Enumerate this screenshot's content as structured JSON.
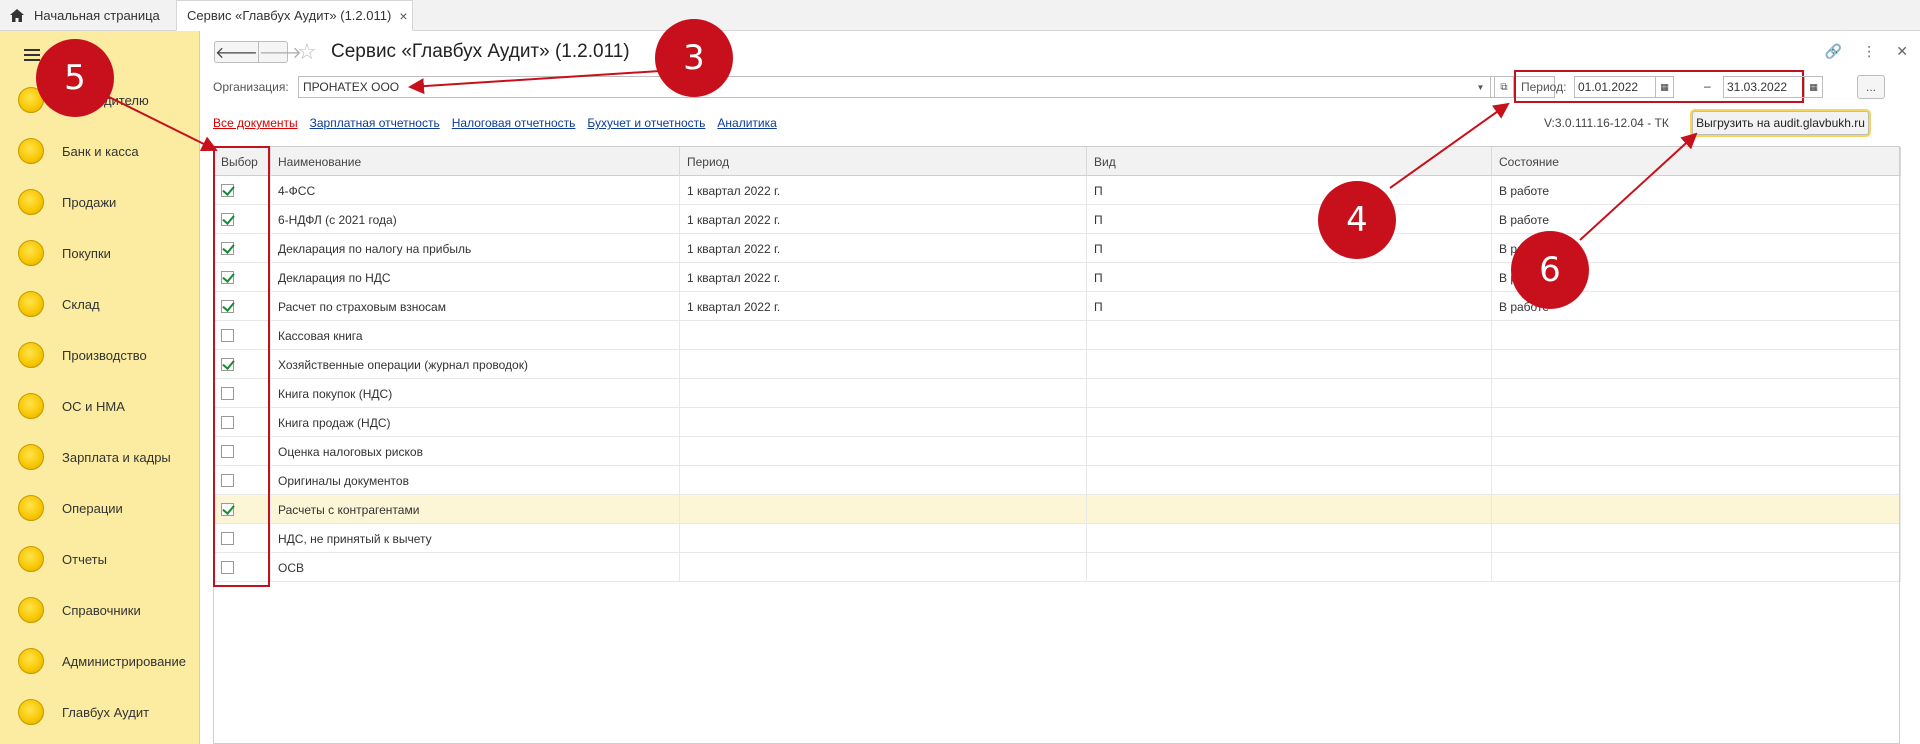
{
  "tabs": {
    "home_label": "Начальная страница",
    "active_label": "Сервис «Главбух Аудит» (1.2.011)",
    "close": "×"
  },
  "sidebar": {
    "items": [
      {
        "label": "Руководителю"
      },
      {
        "label": "Банк и касса"
      },
      {
        "label": "Продажи"
      },
      {
        "label": "Покупки"
      },
      {
        "label": "Склад"
      },
      {
        "label": "Производство"
      },
      {
        "label": "ОС и НМА"
      },
      {
        "label": "Зарплата и кадры"
      },
      {
        "label": "Операции"
      },
      {
        "label": "Отчеты"
      },
      {
        "label": "Справочники"
      },
      {
        "label": "Администрирование"
      },
      {
        "label": "Главбух Аудит"
      }
    ]
  },
  "header": {
    "title": "Сервис «Главбух Аудит» (1.2.011)",
    "back": "🡐",
    "forward": "🡒"
  },
  "org": {
    "label": "Организация:",
    "value": "ПРОНАТЕХ ООО"
  },
  "period": {
    "label": "Период:",
    "from": "01.01.2022",
    "to": "31.03.2022",
    "dash": "–",
    "more": "..."
  },
  "links": [
    "Все документы",
    "Зарплатная отчетность",
    "Налоговая отчетность",
    "Бухучет и отчетность",
    "Аналитика"
  ],
  "version": "V:3.0.111.16-12.04 -  ТК",
  "upload_button": "Выгрузить на audit.glavbukh.ru",
  "table": {
    "columns": [
      "Выбор",
      "Наименование",
      "Период",
      "Вид",
      "Состояние"
    ],
    "rows": [
      {
        "checked": true,
        "name": "4-ФСС",
        "period": "1 квартал 2022 г.",
        "kind": "П",
        "state": "В работе"
      },
      {
        "checked": true,
        "name": "6-НДФЛ (с 2021 года)",
        "period": "1 квартал 2022 г.",
        "kind": "П",
        "state": "В работе"
      },
      {
        "checked": true,
        "name": "Декларация по налогу на прибыль",
        "period": "1 квартал 2022 г.",
        "kind": "П",
        "state": "В работе"
      },
      {
        "checked": true,
        "name": "Декларация по НДС",
        "period": "1 квартал 2022 г.",
        "kind": "П",
        "state": "В работе"
      },
      {
        "checked": true,
        "name": "Расчет по страховым взносам",
        "period": "1 квартал 2022 г.",
        "kind": "П",
        "state": "В работе"
      },
      {
        "checked": false,
        "name": "Кассовая книга",
        "period": "",
        "kind": "",
        "state": ""
      },
      {
        "checked": true,
        "name": "Хозяйственные операции (журнал проводок)",
        "period": "",
        "kind": "",
        "state": ""
      },
      {
        "checked": false,
        "name": "Книга покупок (НДС)",
        "period": "",
        "kind": "",
        "state": ""
      },
      {
        "checked": false,
        "name": "Книга продаж (НДС)",
        "period": "",
        "kind": "",
        "state": ""
      },
      {
        "checked": false,
        "name": "Оценка налоговых рисков",
        "period": "",
        "kind": "",
        "state": ""
      },
      {
        "checked": false,
        "name": "Оригиналы документов",
        "period": "",
        "kind": "",
        "state": ""
      },
      {
        "checked": true,
        "name": "Расчеты с контрагентами",
        "period": "",
        "kind": "",
        "state": "",
        "highlight": true
      },
      {
        "checked": false,
        "name": "НДС, не принятый к вычету",
        "period": "",
        "kind": "",
        "state": ""
      },
      {
        "checked": false,
        "name": "ОСВ",
        "period": "",
        "kind": "",
        "state": ""
      }
    ]
  },
  "annotations": [
    "3",
    "4",
    "5",
    "6"
  ],
  "colors": {
    "sidebar": "#fbeca1",
    "annotation": "#c8101c",
    "link": "#0c3b98",
    "active_link": "#d60000"
  }
}
